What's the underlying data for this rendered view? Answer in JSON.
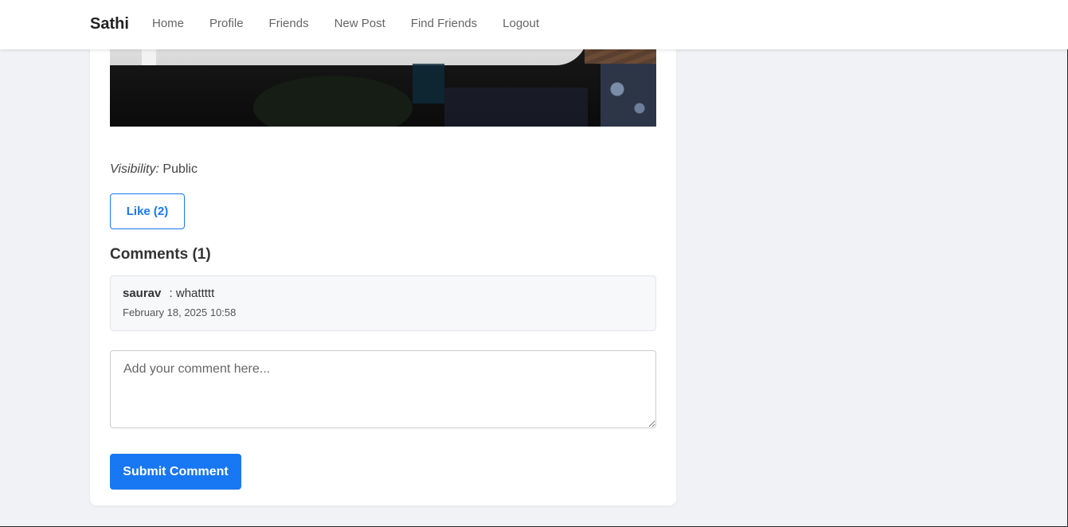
{
  "nav": {
    "brand": "Sathi",
    "links": [
      "Home",
      "Profile",
      "Friends",
      "New Post",
      "Find Friends",
      "Logout"
    ]
  },
  "post": {
    "visibility_label": "Visibility:",
    "visibility_value": "Public",
    "like_label": "Like (2)"
  },
  "comments": {
    "heading": "Comments (1)",
    "items": [
      {
        "author": "saurav",
        "text": ": whattttt",
        "date": "February 18, 2025 10:58"
      }
    ]
  },
  "form": {
    "placeholder": "Add your comment here...",
    "submit_label": "Submit Comment"
  },
  "colors": {
    "accent": "#1877f2",
    "background": "#f0f2f5"
  }
}
